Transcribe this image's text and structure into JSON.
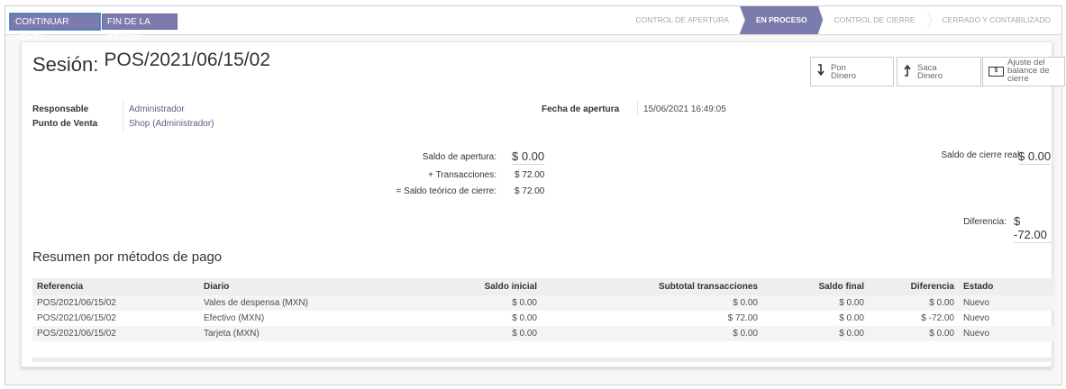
{
  "control_panel": {
    "continue_label": "CONTINUAR VENTA",
    "end_label": "FIN DE LA SESIÓN",
    "stages": [
      {
        "label": "CONTROL DE APERTURA",
        "active": false
      },
      {
        "label": "EN PROCESO",
        "active": true
      },
      {
        "label": "CONTROL DE CIERRE",
        "active": false
      },
      {
        "label": "CERRADO Y CONTABILIZADO",
        "active": false
      }
    ]
  },
  "session": {
    "title_label": "Sesión:",
    "title_ref": "POS/2021/06/15/02",
    "buttons": {
      "pon_line1": "Pon",
      "pon_line2": "Dinero",
      "saca_line1": "Saca",
      "saca_line2": "Dinero",
      "ajuste_line1": "Ajuste del",
      "ajuste_line2": "balance de",
      "ajuste_line3": "cierre"
    },
    "fields": {
      "responsable_label": "Responsable",
      "responsable_value": "Administrador",
      "punto_label": "Punto de Venta",
      "punto_value": "Shop (Administrador)",
      "fecha_label": "Fecha de apertura",
      "fecha_value": "15/06/2021 16:49:05"
    },
    "balance": {
      "apertura_label": "Saldo de apertura:",
      "apertura_value": "$ 0.00",
      "transacciones_label": "+ Transacciones:",
      "transacciones_value": "$ 72.00",
      "teorico_label": "= Saldo teórico de cierre:",
      "teorico_value": "$ 72.00",
      "cierre_real_label": "Saldo de cierre real:",
      "cierre_real_value": "$ 0.00",
      "diferencia_label": "Diferencia:",
      "diferencia_value": "$ -72.00"
    }
  },
  "payments": {
    "section_title": "Resumen por métodos de pago",
    "headers": [
      "Referencia",
      "Diario",
      "Saldo inicial",
      "Subtotal transacciones",
      "Saldo final",
      "Diferencia",
      "Estado"
    ],
    "rows": [
      [
        "POS/2021/06/15/02",
        "Vales de despensa (MXN)",
        "$ 0.00",
        "$ 0.00",
        "$ 0.00",
        "$ 0.00",
        "Nuevo"
      ],
      [
        "POS/2021/06/15/02",
        "Efectivo (MXN)",
        "$ 0.00",
        "$ 72.00",
        "$ 0.00",
        "$ -72.00",
        "Nuevo"
      ],
      [
        "POS/2021/06/15/02",
        "Tarjeta (MXN)",
        "$ 0.00",
        "$ 0.00",
        "$ 0.00",
        "$ 0.00",
        "Nuevo"
      ]
    ]
  },
  "colors": {
    "primary": "#7c7bad",
    "link": "#5b5b8e"
  }
}
